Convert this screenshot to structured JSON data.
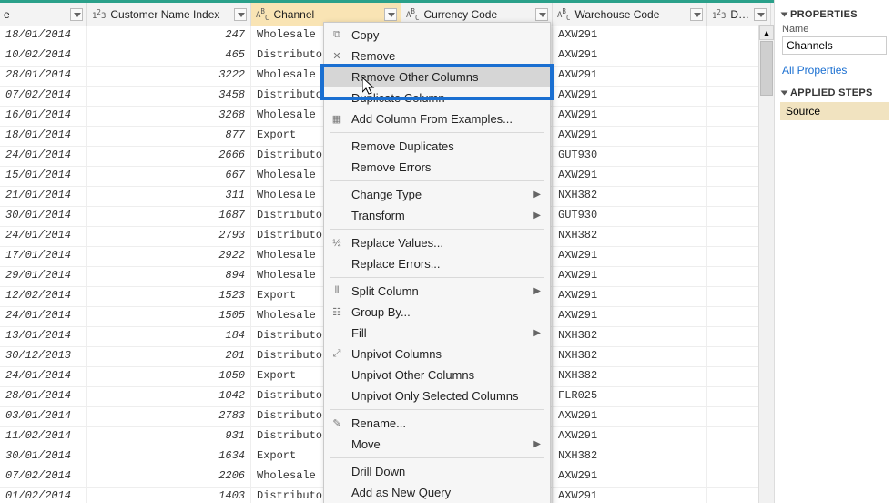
{
  "columns": [
    {
      "label": "e",
      "type": "",
      "width": "c0"
    },
    {
      "label": "Customer Name Index",
      "type": "123",
      "width": "c1"
    },
    {
      "label": "Channel",
      "type": "ABC",
      "width": "c2",
      "selected": true
    },
    {
      "label": "Currency Code",
      "type": "ABC",
      "width": "c3"
    },
    {
      "label": "Warehouse Code",
      "type": "ABC",
      "width": "c4"
    },
    {
      "label": "Deliver",
      "type": "123",
      "width": "c5"
    }
  ],
  "rows": [
    {
      "date": "18/01/2014",
      "idx": 247,
      "channel": "Wholesale",
      "wh": "AXW291"
    },
    {
      "date": "10/02/2014",
      "idx": 465,
      "channel": "Distributo",
      "wh": "AXW291"
    },
    {
      "date": "28/01/2014",
      "idx": 3222,
      "channel": "Wholesale",
      "wh": "AXW291"
    },
    {
      "date": "07/02/2014",
      "idx": 3458,
      "channel": "Distributo",
      "wh": "AXW291"
    },
    {
      "date": "16/01/2014",
      "idx": 3268,
      "channel": "Wholesale",
      "wh": "AXW291"
    },
    {
      "date": "18/01/2014",
      "idx": 877,
      "channel": "Export",
      "wh": "AXW291"
    },
    {
      "date": "24/01/2014",
      "idx": 2666,
      "channel": "Distributo",
      "wh": "GUT930"
    },
    {
      "date": "15/01/2014",
      "idx": 667,
      "channel": "Wholesale",
      "wh": "AXW291"
    },
    {
      "date": "21/01/2014",
      "idx": 311,
      "channel": "Wholesale",
      "wh": "NXH382"
    },
    {
      "date": "30/01/2014",
      "idx": 1687,
      "channel": "Distributo",
      "wh": "GUT930"
    },
    {
      "date": "24/01/2014",
      "idx": 2793,
      "channel": "Distributo",
      "wh": "NXH382"
    },
    {
      "date": "17/01/2014",
      "idx": 2922,
      "channel": "Wholesale",
      "wh": "AXW291"
    },
    {
      "date": "29/01/2014",
      "idx": 894,
      "channel": "Wholesale",
      "wh": "AXW291"
    },
    {
      "date": "12/02/2014",
      "idx": 1523,
      "channel": "Export",
      "wh": "AXW291"
    },
    {
      "date": "24/01/2014",
      "idx": 1505,
      "channel": "Wholesale",
      "wh": "AXW291"
    },
    {
      "date": "13/01/2014",
      "idx": 184,
      "channel": "Distributo",
      "wh": "NXH382"
    },
    {
      "date": "30/12/2013",
      "idx": 201,
      "channel": "Distributo",
      "wh": "NXH382"
    },
    {
      "date": "24/01/2014",
      "idx": 1050,
      "channel": "Export",
      "wh": "NXH382"
    },
    {
      "date": "28/01/2014",
      "idx": 1042,
      "channel": "Distributo",
      "wh": "FLR025"
    },
    {
      "date": "03/01/2014",
      "idx": 2783,
      "channel": "Distributo",
      "wh": "AXW291"
    },
    {
      "date": "11/02/2014",
      "idx": 931,
      "channel": "Distributo",
      "wh": "AXW291"
    },
    {
      "date": "30/01/2014",
      "idx": 1634,
      "channel": "Export",
      "wh": "NXH382"
    },
    {
      "date": "07/02/2014",
      "idx": 2206,
      "channel": "Wholesale",
      "wh": "AXW291"
    },
    {
      "date": "01/02/2014",
      "idx": 1403,
      "channel": "Distributo",
      "wh": "AXW291"
    }
  ],
  "context_menu": [
    {
      "label": "Copy",
      "icon": "⧉"
    },
    {
      "label": "Remove",
      "icon": "✕"
    },
    {
      "label": "Remove Other Columns",
      "hover": true
    },
    {
      "label": "Duplicate Column"
    },
    {
      "label": "Add Column From Examples...",
      "icon": "▦"
    },
    {
      "sep": true
    },
    {
      "label": "Remove Duplicates"
    },
    {
      "label": "Remove Errors"
    },
    {
      "sep": true
    },
    {
      "label": "Change Type",
      "submenu": true
    },
    {
      "label": "Transform",
      "submenu": true
    },
    {
      "sep": true
    },
    {
      "label": "Replace Values...",
      "icon": "½"
    },
    {
      "label": "Replace Errors..."
    },
    {
      "sep": true
    },
    {
      "label": "Split Column",
      "icon": "⫴",
      "submenu": true
    },
    {
      "label": "Group By...",
      "icon": "☷"
    },
    {
      "label": "Fill",
      "submenu": true
    },
    {
      "label": "Unpivot Columns",
      "icon": "⤢"
    },
    {
      "label": "Unpivot Other Columns"
    },
    {
      "label": "Unpivot Only Selected Columns"
    },
    {
      "sep": true
    },
    {
      "label": "Rename...",
      "icon": "✎"
    },
    {
      "label": "Move",
      "submenu": true
    },
    {
      "sep": true
    },
    {
      "label": "Drill Down"
    },
    {
      "label": "Add as New Query"
    }
  ],
  "side": {
    "properties_header": "PROPERTIES",
    "name_label": "Name",
    "name_value": "Channels",
    "all_properties": "All Properties",
    "steps_header": "APPLIED STEPS",
    "step": "Source"
  }
}
